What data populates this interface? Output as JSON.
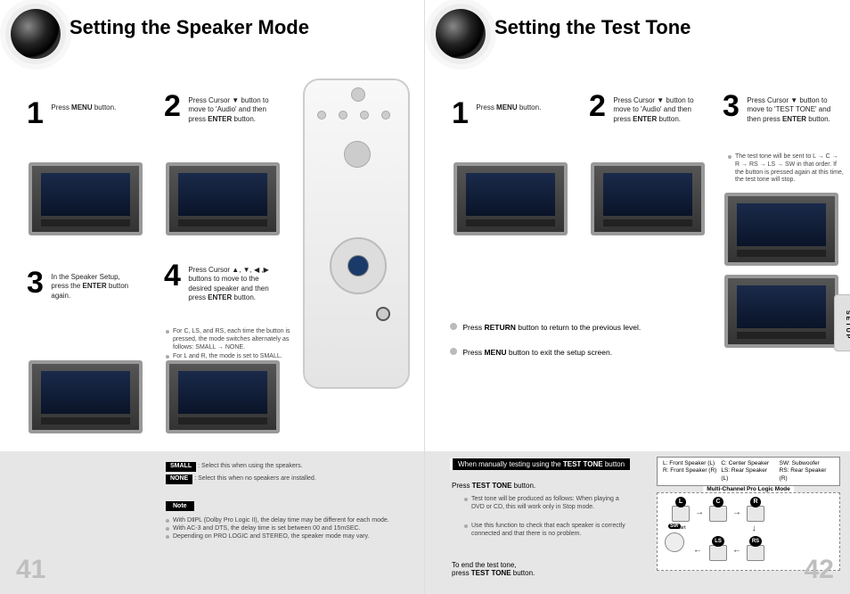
{
  "left": {
    "title": "Setting the Speaker Mode",
    "step1": {
      "num": "1",
      "text_pre": "Press ",
      "bold1": "MENU",
      "text_post": " button."
    },
    "step2": {
      "num": "2",
      "text": "Press Cursor ▼ button to move to 'Audio' and then press ",
      "bold": "ENTER",
      "text2": " button."
    },
    "step3": {
      "num": "3",
      "text": "In the Speaker Setup, press the ",
      "bold": "ENTER",
      "text2": " button again."
    },
    "step4": {
      "num": "4",
      "text": "Press Cursor ▲, ▼, ◀ ,▶ buttons to move to the desired speaker and then press ",
      "bold": "ENTER",
      "text2": " button."
    },
    "step4_bullets": [
      "For C, LS, and RS, each time the button is pressed, the mode switches alternately as follows: SMALL → NONE.",
      "For L and R, the mode is set to SMALL."
    ],
    "small_label": "SMALL",
    "small_text": ": Select this when using the speakers.",
    "none_label": "NONE",
    "none_text": ": Select this when no speakers are installed.",
    "note_label": "Note",
    "notes": [
      "With DⅡPL (Dolby Pro Logic II), the delay time may be different for each mode.",
      "With AC-3 and DTS, the delay time is set between 00 and 15mSEC.",
      "Depending on PRO LOGIC and STEREO, the speaker mode may vary."
    ],
    "page_num": "41"
  },
  "right": {
    "title": "Setting the Test Tone",
    "step1": {
      "num": "1",
      "text_pre": "Press ",
      "bold1": "MENU",
      "text_post": " button."
    },
    "step2": {
      "num": "2",
      "text": "Press Cursor ▼ button to move to 'Audio' and then press ",
      "bold": "ENTER",
      "text2": " button."
    },
    "step3": {
      "num": "3",
      "text": "Press Cursor ▼ button to move to 'TEST TONE' and then press ",
      "bold": "ENTER",
      "text2": " button."
    },
    "step3_bullet": "The test tone will be sent to L → C → R → RS → LS → SW in that order. If the button is pressed again at this time, the test tone will stop.",
    "return_line_pre": "Press ",
    "return_bold": "RETURN",
    "return_line_post": " button to return to the previous level.",
    "menu_line_pre": "Press ",
    "menu_bold": "MENU",
    "menu_line_post": " button to exit the setup screen.",
    "manual_heading_pre": "When manually testing using the ",
    "manual_heading_bold": "TEST TONE",
    "manual_heading_post": " button",
    "press_testtone_pre": "Press ",
    "press_testtone_bold": "TEST TONE",
    "press_testtone_post": " button.",
    "manual_bullets": [
      "Test tone will be produced as follows: When playing a DVD or CD, this will work only in Stop mode.",
      "Use this function to check that each speaker is correctly connected and that there is no problem."
    ],
    "end_line_pre": "To end the test tone,\npress ",
    "end_bold": "TEST TONE",
    "end_line_post": " button.",
    "legend": {
      "L": "L: Front Speaker (L)",
      "R": "R: Front Speaker (R)",
      "C": "C: Center Speaker",
      "LS": "LS: Rear Speaker (L)",
      "SW": "SW: Subwoofer",
      "RS": "RS: Rear Speaker (R)"
    },
    "flow_title": "Multi-Channel Pro Logic Mode",
    "flow_labels": {
      "L": "L",
      "C": "C",
      "R": "R",
      "SW": "SW",
      "LS": "LS",
      "RS": "RS",
      "start": "Start"
    },
    "setup_tab": "SETUP",
    "page_num": "42"
  }
}
